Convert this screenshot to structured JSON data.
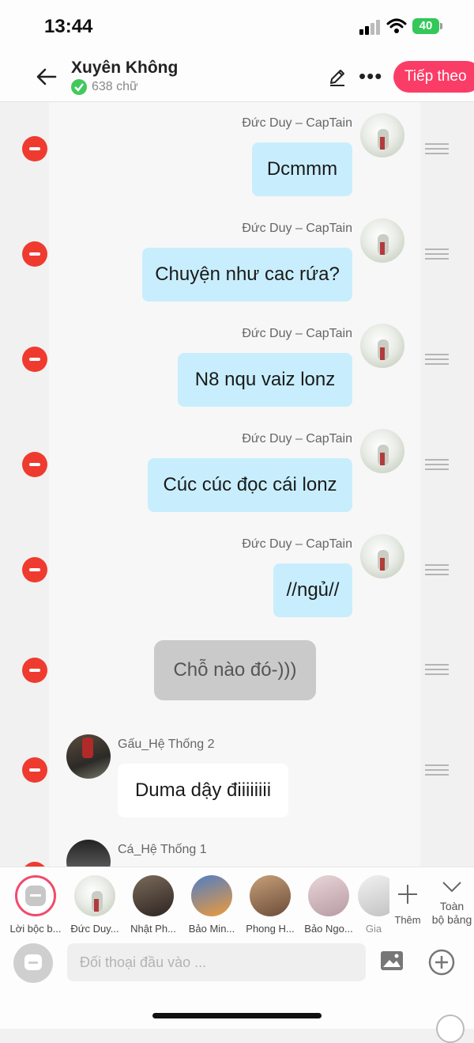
{
  "status_bar": {
    "time": "13:44",
    "battery": "40"
  },
  "header": {
    "title": "Xuyên Không",
    "word_count": "638 chữ",
    "next_label": "Tiếp theo"
  },
  "messages": [
    {
      "speaker": "Đức Duy – CapTain",
      "text": "Dcmmm"
    },
    {
      "speaker": "Đức Duy – CapTain",
      "text": "Chuyện như cac rứa?"
    },
    {
      "speaker": "Đức Duy – CapTain",
      "text": "N8 nqu vaiz lonz"
    },
    {
      "speaker": "Đức Duy – CapTain",
      "text": "Cúc cúc đọc cái lonz"
    },
    {
      "speaker": "Đức Duy – CapTain",
      "text": "//ngủ//"
    },
    {
      "speaker": "",
      "text": "Chỗ nào đó-)))"
    },
    {
      "speaker": "Gấu_Hệ Thống 2",
      "text": "Duma dậy điiiiiiii"
    },
    {
      "speaker": "Cá_Hệ Thống 1",
      "text": ""
    }
  ],
  "characters": [
    {
      "label": "Lời bộc b..."
    },
    {
      "label": "Đức Duy..."
    },
    {
      "label": "Nhật Ph..."
    },
    {
      "label": "Bảo Min..."
    },
    {
      "label": "Phong H..."
    },
    {
      "label": "Bảo Ngo..."
    },
    {
      "label": "Gia"
    }
  ],
  "bottom": {
    "more_label": "Thêm",
    "all_label_1": "Toàn",
    "all_label_2": "bộ bảng",
    "input_placeholder": "Đối thoại đầu vào ..."
  },
  "colors": {
    "accent": "#fa3d67",
    "bubble_blue": "#c8eefd",
    "delete_red": "#ef3b2f"
  },
  "icons": [
    "back-arrow-icon",
    "check-icon",
    "pencil-icon",
    "more-icon",
    "plus-icon",
    "chevron-down-icon",
    "chat-icon",
    "image-icon",
    "add-circle-icon"
  ]
}
